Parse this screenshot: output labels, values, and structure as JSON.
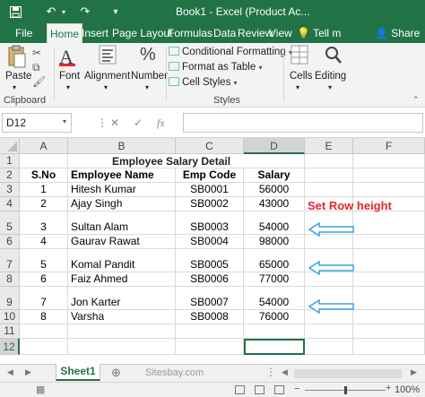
{
  "titlebar": {
    "title": "Book1 - Excel (Product Ac...",
    "save_icon": "save-icon",
    "undo_icon": "undo-icon",
    "redo_icon": "redo-icon"
  },
  "tabs": [
    "File",
    "Home",
    "Insert",
    "Page Layout",
    "Formulas",
    "Data",
    "Review",
    "View"
  ],
  "tell_me": "Tell m",
  "share_label": "Share",
  "ribbon": {
    "clipboard_label": "Clipboard",
    "paste_label": "Paste",
    "font_label": "Font",
    "alignment_label": "Alignment",
    "number_label": "Number",
    "conditional_formatting": "Conditional Formatting",
    "format_as_table": "Format as Table",
    "cell_styles": "Cell Styles",
    "styles_label": "Styles",
    "cells_label": "Cells",
    "editing_label": "Editing"
  },
  "formula_bar": {
    "name_box": "D12",
    "fx": "fx",
    "value": ""
  },
  "columns": [
    "A",
    "B",
    "C",
    "D",
    "E",
    "F"
  ],
  "selected_column": "D",
  "rows": [
    "1",
    "2",
    "3",
    "4",
    "5",
    "6",
    "7",
    "8",
    "9",
    "10",
    "11",
    "12"
  ],
  "selected_row": "12",
  "sheet": {
    "title": "Employee Salary Detail",
    "headers": [
      "S.No",
      "Employee Name",
      "Emp Code",
      "Salary"
    ],
    "data": [
      [
        "1",
        "Hitesh Kumar",
        "SB0001",
        "56000"
      ],
      [
        "2",
        "Ajay Singh",
        "SB0002",
        "43000"
      ],
      [
        "3",
        "Sultan Alam",
        "SB0003",
        "54000"
      ],
      [
        "4",
        "Gaurav Rawat",
        "SB0004",
        "98000"
      ],
      [
        "5",
        "Komal Pandit",
        "SB0005",
        "65000"
      ],
      [
        "6",
        "Faiz Ahmed",
        "SB0006",
        "77000"
      ],
      [
        "7",
        "Jon Karter",
        "SB0007",
        "54000"
      ],
      [
        "8",
        "Varsha",
        "SB0008",
        "76000"
      ]
    ]
  },
  "annotation": "Set Row height",
  "annotation_color": "#e3262b",
  "arrow_color": "#3aa0e0",
  "sheet_tab": "Sheet1",
  "watermark": "Sitesbay.com",
  "status": {
    "ready": "",
    "zoom": "100%"
  },
  "accent": "#217346"
}
